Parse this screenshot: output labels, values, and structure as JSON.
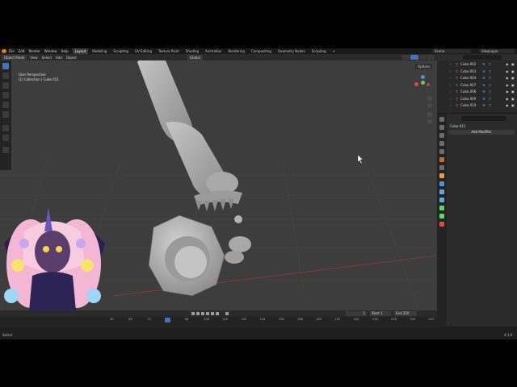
{
  "menubar": {
    "menus": [
      "File",
      "Edit",
      "Render",
      "Window",
      "Help"
    ],
    "workspaces": [
      "Layout",
      "Modeling",
      "Sculpting",
      "UV Editing",
      "Texture Paint",
      "Shading",
      "Animation",
      "Rendering",
      "Compositing",
      "Geometry Nodes",
      "Scripting"
    ],
    "active_workspace": "Layout",
    "add_workspace": "+",
    "scene": "Scene",
    "view_layer": "ViewLayer"
  },
  "viewport": {
    "mode": "Object Mode",
    "menus": [
      "View",
      "Select",
      "Add",
      "Object"
    ],
    "transform_orientation": "Global",
    "overlay_title": "User Perspective",
    "overlay_subtitle": "(1) Collection | Cube.011",
    "options_label": "Options",
    "gizmo_colors": {
      "x": "#e0444c",
      "y": "#7cc44a",
      "z": "#4f8fe0"
    }
  },
  "timeline": {
    "current_frame": "1",
    "start_label": "Start",
    "start_value": "1",
    "end_label": "End",
    "end_value": "250",
    "ticks": [
      "40",
      "60",
      "72",
      "84",
      "96",
      "108",
      "120",
      "132",
      "144",
      "156",
      "168",
      "180",
      "192",
      "204",
      "216",
      "228",
      "240",
      "252"
    ],
    "cursor_frame": "84"
  },
  "statusbar": {
    "left": "Select",
    "version": "4.1.0"
  },
  "outliner": {
    "rows": [
      "Cube.002",
      "Cube.003",
      "Cube.004",
      "Cube.007",
      "Cube.008",
      "Cube.009",
      "Cube.010"
    ]
  },
  "properties": {
    "object_name": "Cube.011",
    "add_modifier_label": "Add Modifier"
  },
  "colors": {
    "accent": "#4772b3",
    "background": "#3d3d3d",
    "model": "#b4b4b4",
    "blender_logo": "#e87d0d"
  }
}
